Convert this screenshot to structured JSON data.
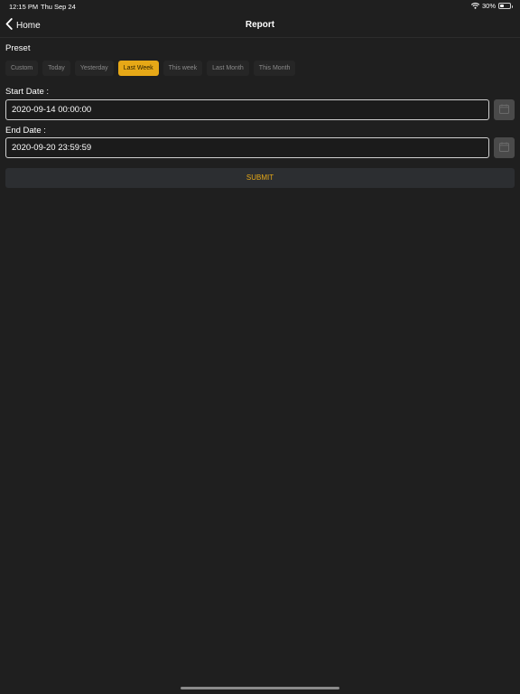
{
  "status_bar": {
    "time": "12:15 PM",
    "date": "Thu Sep 24",
    "battery_text": "30%",
    "battery_level": 0.3
  },
  "nav": {
    "back_label": "Home",
    "title": "Report"
  },
  "preset": {
    "label": "Preset",
    "selected": "Last Week",
    "options": [
      "Custom",
      "Today",
      "Yesterday",
      "Last Week",
      "This week",
      "Last Month",
      "This Month"
    ]
  },
  "start_date": {
    "label": "Start Date :",
    "value": "2020-09-14 00:00:00"
  },
  "end_date": {
    "label": "End Date :",
    "value": "2020-09-20 23:59:59"
  },
  "submit": {
    "label": "SUBMIT"
  },
  "colors": {
    "background": "#1f1f1f",
    "accent": "#e6a817",
    "button_bg": "#262626",
    "calendar_button_bg": "#4a4a4a"
  }
}
